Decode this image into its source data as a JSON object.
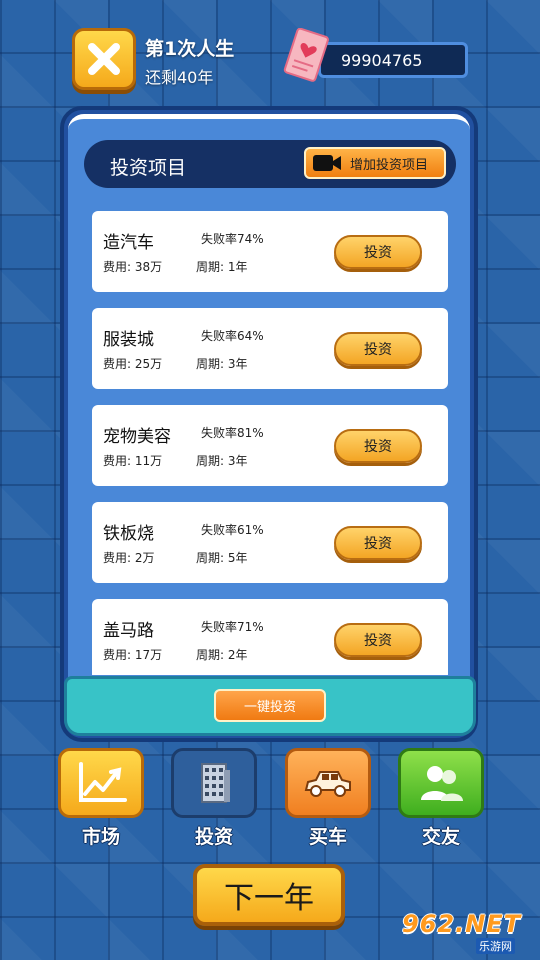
{
  "header": {
    "life_title": "第1次人生",
    "years_left": "还剩40年",
    "money": "99904765"
  },
  "panel": {
    "title": "投资项目",
    "add_invest_label": "增加投资项目",
    "one_click_label": "一键投资"
  },
  "projects": [
    {
      "name": "造汽车",
      "fail_rate": "失败率74%",
      "cost": "费用: 38万",
      "period": "周期: 1年",
      "button": "投资"
    },
    {
      "name": "服装城",
      "fail_rate": "失败率64%",
      "cost": "费用: 25万",
      "period": "周期: 3年",
      "button": "投资"
    },
    {
      "name": "宠物美容",
      "fail_rate": "失败率81%",
      "cost": "费用: 11万",
      "period": "周期: 3年",
      "button": "投资"
    },
    {
      "name": "铁板烧",
      "fail_rate": "失败率61%",
      "cost": "费用: 2万",
      "period": "周期: 5年",
      "button": "投资"
    },
    {
      "name": "盖马路",
      "fail_rate": "失败率71%",
      "cost": "费用: 17万",
      "period": "周期: 2年",
      "button": "投资"
    }
  ],
  "nav": [
    {
      "label": "市场",
      "icon": "chart-icon"
    },
    {
      "label": "投资",
      "icon": "building-icon"
    },
    {
      "label": "买车",
      "icon": "car-icon"
    },
    {
      "label": "交友",
      "icon": "friends-icon"
    }
  ],
  "next_year_label": "下一年",
  "watermark": {
    "brand": "962.NET",
    "sub": "乐游网"
  },
  "colors": {
    "background": "#2a64a8",
    "button_yellow": "#f5a91b",
    "button_orange": "#f07f10",
    "footer_teal": "#38c3c7"
  }
}
